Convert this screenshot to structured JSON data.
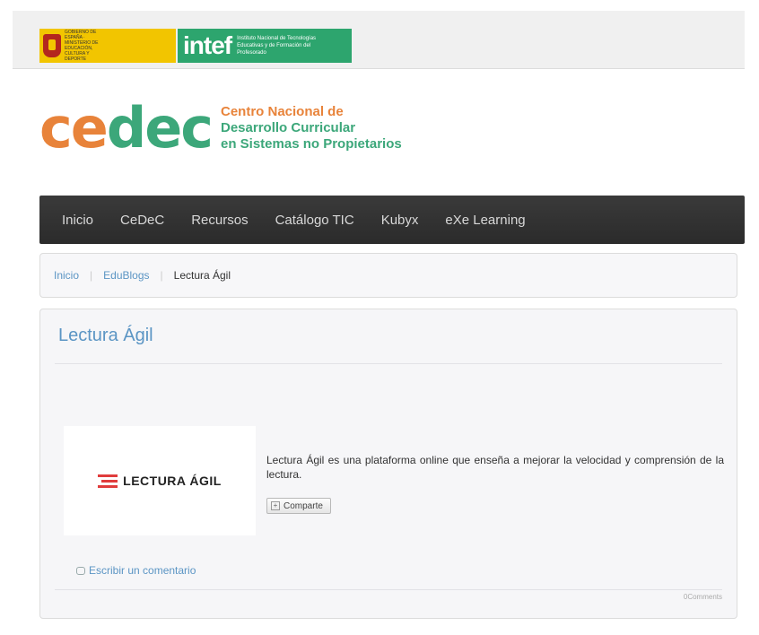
{
  "header": {
    "gov_text": "GOBIERNO DE ESPAÑA · MINISTERIO DE EDUCACIÓN, CULTURA Y DEPORTE",
    "intef_word": "intef",
    "intef_sub": "Instituto Nacional de Tecnologías Educativas y de Formación del Profesorado",
    "cedec_part1": "ce",
    "cedec_part2": "dec",
    "cedec_tag_1": "Centro Nacional de",
    "cedec_tag_2": "Desarrollo Curricular",
    "cedec_tag_3": "en Sistemas no Propietarios"
  },
  "nav": {
    "items": [
      {
        "label": "Inicio"
      },
      {
        "label": "CeDeC"
      },
      {
        "label": "Recursos"
      },
      {
        "label": "Catálogo TIC"
      },
      {
        "label": "Kubyx"
      },
      {
        "label": "eXe Learning"
      }
    ]
  },
  "breadcrumb": {
    "items": [
      "Inicio",
      "EduBlogs"
    ],
    "current": "Lectura Ágil"
  },
  "article": {
    "title": "Lectura Ágil",
    "logo_text": "LECTURA ÁGIL",
    "description": "Lectura Ágil es una plataforma online que enseña a mejorar la velocidad y comprensión de la lectura.",
    "share_label": "Comparte",
    "comment_link": "Escribir un comentario",
    "comments_count": "0Comments"
  },
  "colors": {
    "orange": "#e8833a",
    "green": "#3ca77a",
    "link": "#5b95c4",
    "nav_bg": "#2f2f2f"
  }
}
